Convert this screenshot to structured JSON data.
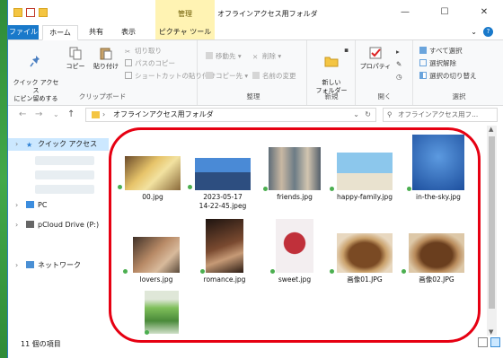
{
  "window": {
    "title": "オフラインアクセス用フォルダ",
    "context_tab_group": "管理",
    "controls": {
      "minimize": "—",
      "maximize": "☐",
      "close": "✕"
    }
  },
  "tabs": [
    {
      "label": "ファイル"
    },
    {
      "label": "ホーム"
    },
    {
      "label": "共有"
    },
    {
      "label": "表示"
    },
    {
      "label": "ピクチャ ツール"
    }
  ],
  "ribbon": {
    "clipboard": {
      "group_label": "クリップボード",
      "pin_quick_access": "クイック アクセス\nにピン留めする",
      "copy": "コピー",
      "paste": "貼り付け",
      "cut": "切り取り",
      "copy_path": "パスのコピー",
      "paste_shortcut": "ショートカットの貼り付け"
    },
    "organize": {
      "group_label": "整理",
      "move_to": "移動先",
      "copy_to": "コピー先",
      "delete": "削除",
      "rename": "名前の変更"
    },
    "new": {
      "group_label": "新規",
      "new_folder": "新しい\nフォルダー"
    },
    "open": {
      "group_label": "開く",
      "properties": "プロパティ"
    },
    "select": {
      "group_label": "選択",
      "select_all": "すべて選択",
      "select_none": "選択解除",
      "invert_selection": "選択の切り替え"
    }
  },
  "address": {
    "path": "オフラインアクセス用フォルダ",
    "search_placeholder": "オフラインアクセス用フ..."
  },
  "nav_pane": {
    "quick_access": "クイック アクセス",
    "pc": "PC",
    "pcloud": "pCloud Drive (P:)",
    "network": "ネットワーク"
  },
  "files": [
    {
      "name": "00.jpg"
    },
    {
      "name": "2023-05-17\n14-22-45.jpeg"
    },
    {
      "name": "friends.jpg"
    },
    {
      "name": "happy-family.jpg"
    },
    {
      "name": "in-the-sky.jpg"
    },
    {
      "name": "lovers.jpg"
    },
    {
      "name": "romance.jpg"
    },
    {
      "name": "sweet.jpg"
    },
    {
      "name": "画像01.JPG"
    },
    {
      "name": "画像02.JPG"
    },
    {
      "name": ""
    }
  ],
  "status": {
    "item_count": "11 個の項目"
  },
  "colors": {
    "file_tab": "#1979ca",
    "context_tab": "#fff3b3",
    "annotation": "#e60012",
    "sync_ok": "#4caf50"
  }
}
